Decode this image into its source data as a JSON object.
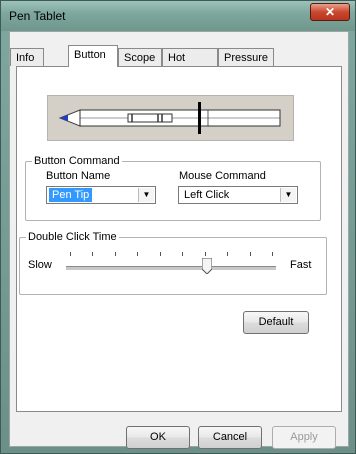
{
  "window": {
    "title": "Pen Tablet",
    "close_glyph": "✕"
  },
  "tabs": [
    {
      "label": "Info"
    },
    {
      "label": "Button"
    },
    {
      "label": "Scope"
    },
    {
      "label": "Hot Cells"
    },
    {
      "label": "Pressure"
    }
  ],
  "active_tab": "Button",
  "button_command": {
    "group_label": "Button Command",
    "button_name_label": "Button Name",
    "button_name_value": "Pen Tip",
    "mouse_command_label": "Mouse Command",
    "mouse_command_value": "Left Click"
  },
  "double_click": {
    "group_label": "Double Click Time",
    "slow_label": "Slow",
    "fast_label": "Fast",
    "tick_count": 10,
    "slider_position": 0.67
  },
  "default_button": "Default",
  "footer": {
    "ok": "OK",
    "cancel": "Cancel",
    "apply": "Apply"
  },
  "colors": {
    "pen_tip_accent": "#1f3fd1",
    "selection": "#3399ff"
  },
  "icons": {
    "dropdown": "chevron-down-icon",
    "slider": "slider-thumb"
  }
}
